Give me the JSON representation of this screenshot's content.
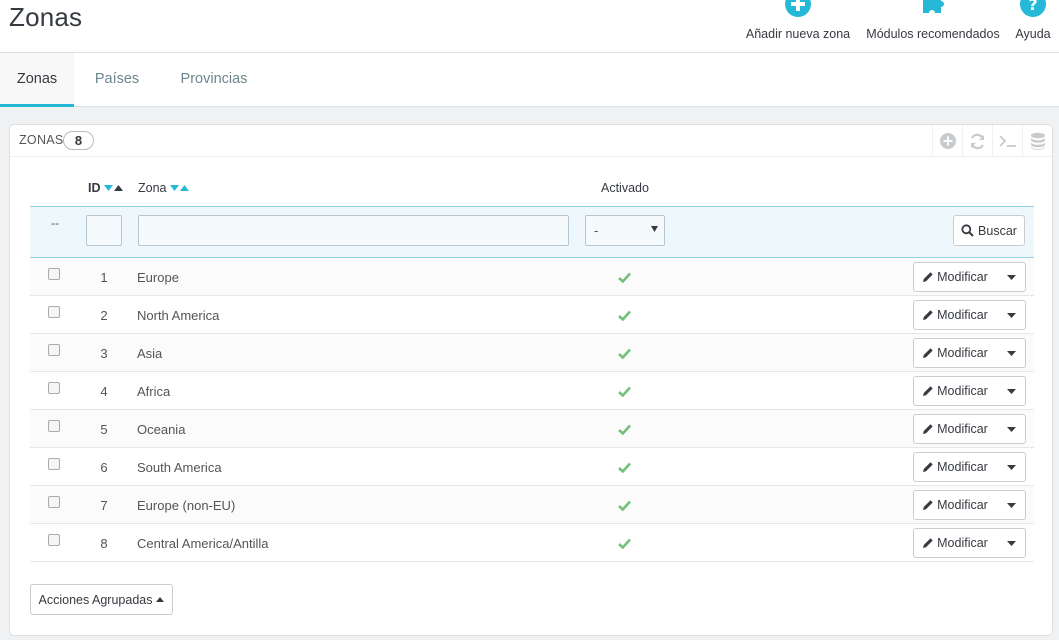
{
  "header": {
    "title": "Zonas",
    "toolbar": [
      {
        "label": "Añadir nueva zona",
        "icon": "plus-circle-icon"
      },
      {
        "label": "Módulos recomendados",
        "icon": "puzzle-icon"
      },
      {
        "label": "Ayuda",
        "icon": "help-icon"
      }
    ]
  },
  "tabs": [
    {
      "label": "Zonas",
      "active": true
    },
    {
      "label": "Países",
      "active": false
    },
    {
      "label": "Provincias",
      "active": false
    }
  ],
  "panel": {
    "title": "ZONAS",
    "count": "8",
    "columns": {
      "id": "ID",
      "name": "Zona",
      "active": "Activado"
    },
    "filter": {
      "dash": "--",
      "active_select": "-",
      "search_label": "Buscar"
    },
    "rows": [
      {
        "id": "1",
        "name": "Europe",
        "active": true
      },
      {
        "id": "2",
        "name": "North America",
        "active": true
      },
      {
        "id": "3",
        "name": "Asia",
        "active": true
      },
      {
        "id": "4",
        "name": "Africa",
        "active": true
      },
      {
        "id": "5",
        "name": "Oceania",
        "active": true
      },
      {
        "id": "6",
        "name": "South America",
        "active": true
      },
      {
        "id": "7",
        "name": "Europe (non-EU)",
        "active": true
      },
      {
        "id": "8",
        "name": "Central America/Antilla",
        "active": true
      }
    ],
    "row_action_label": "Modificar",
    "bulk_actions_label": "Acciones Agrupadas"
  },
  "colors": {
    "accent": "#25b9d7",
    "success": "#72c279",
    "text_dark": "#363a41"
  }
}
